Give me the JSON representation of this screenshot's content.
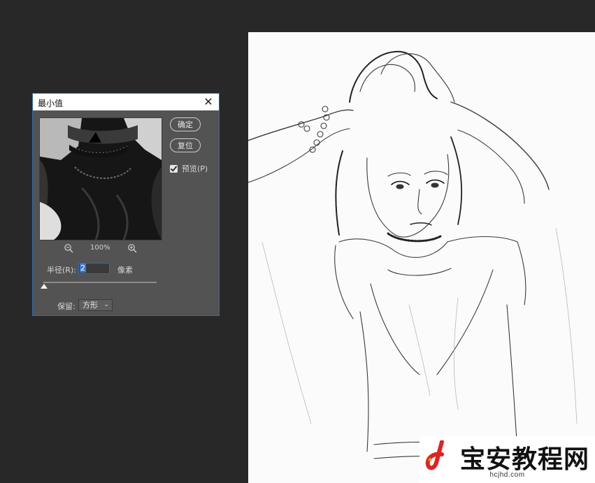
{
  "dialog": {
    "title": "最小值",
    "ok_label": "确定",
    "reset_label": "复位",
    "preview_label": "预览(P)",
    "preview_checked": true,
    "zoom_level": "100%",
    "zoom_out_icon": "zoom-out-icon",
    "zoom_in_icon": "zoom-in-icon",
    "radius_label": "半径(R):",
    "radius_value": "2",
    "radius_unit": "像素",
    "keep_label": "保留:",
    "keep_value": "方形"
  },
  "watermark": {
    "text": "宝安教程网",
    "url": "hcjhd.com"
  },
  "colors": {
    "workspace_bg": "#282828",
    "dialog_bg": "#535353",
    "accent": "#2a6fb0",
    "logo_red": "#e02222"
  }
}
